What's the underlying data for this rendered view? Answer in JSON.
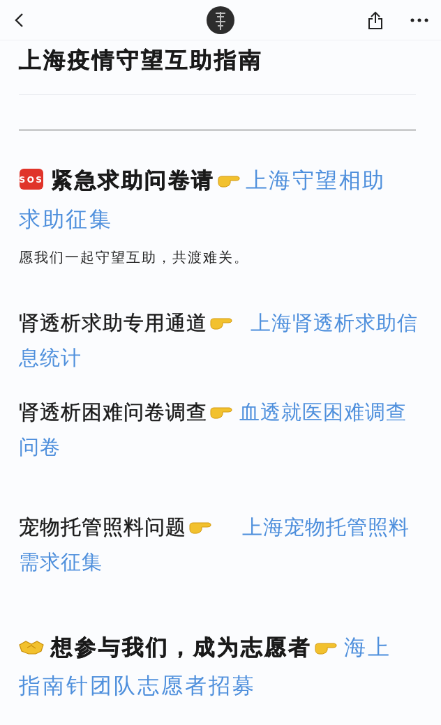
{
  "title": "上海疫情守望互助指南",
  "sections": [
    {
      "kind": "sos",
      "badge": "SOS",
      "text": "紧急求助问卷请",
      "link_lines": [
        "上海守望相助",
        "求助征集"
      ],
      "note": "愿我们一起守望互助，共渡难关。"
    },
    {
      "kind": "plain",
      "text": "肾透析求助专用通道",
      "link_lines": [
        "上海肾透析求助信",
        "息统计"
      ]
    },
    {
      "kind": "plain",
      "text": "肾透析困难问卷调查",
      "link_lines": [
        "血透就医困难调查",
        "问卷"
      ]
    },
    {
      "kind": "plain",
      "text": "宠物托管照料问题",
      "link_lines": [
        "上海宠物托管照料",
        "需求征集"
      ]
    },
    {
      "kind": "handshake",
      "text": "想参与我们，成为志愿者",
      "link_lines": [
        "海上",
        "指南针团队志愿者招募"
      ]
    }
  ]
}
